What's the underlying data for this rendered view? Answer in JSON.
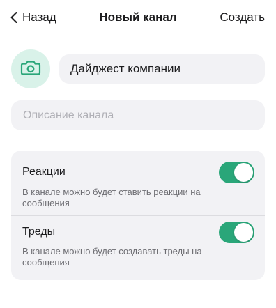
{
  "header": {
    "back_label": "Назад",
    "title": "Новый канал",
    "create_label": "Создать"
  },
  "photo": {
    "icon": "camera-icon"
  },
  "form": {
    "name_value": "Дайджест компании",
    "description_placeholder": "Описание канала"
  },
  "settings": {
    "reactions": {
      "label": "Реакции",
      "description": "В канале можно будет ставить реакции на сообщения",
      "enabled": true
    },
    "threads": {
      "label": "Треды",
      "description": "В канале можно будет создавать треды на сообщения",
      "enabled": true
    }
  },
  "colors": {
    "accent": "#2aa679",
    "accent_light": "#d9f2e9",
    "field_background": "#f2f2f5",
    "placeholder": "#b0b0b6",
    "secondary_text": "#6d6d72"
  }
}
